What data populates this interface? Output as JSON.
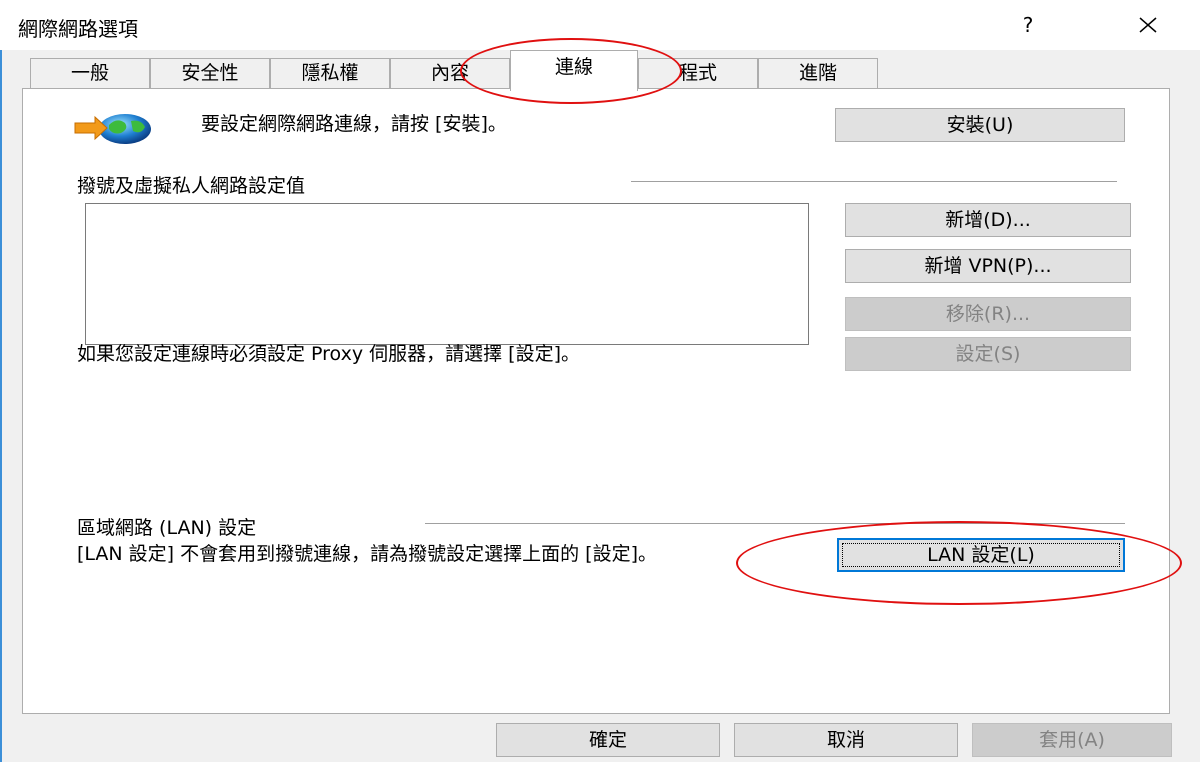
{
  "window": {
    "title": "網際網路選項",
    "help_glyph": "?",
    "close_glyph": "✕"
  },
  "tabs": [
    {
      "label": "一般"
    },
    {
      "label": "安全性"
    },
    {
      "label": "隱私權"
    },
    {
      "label": "內容"
    },
    {
      "label": "連線",
      "active": true
    },
    {
      "label": "程式"
    },
    {
      "label": "進階"
    }
  ],
  "setup": {
    "text": "要設定網際網路連線，請按 [安裝]。",
    "button": "安裝(U)",
    "icon": "network-setup-icon"
  },
  "dialup": {
    "heading": "撥號及虛擬私人網路設定值",
    "add_button": "新增(D)...",
    "add_vpn_button": "新增 VPN(P)...",
    "remove_button": "移除(R)...",
    "settings_button": "設定(S)",
    "proxy_note": "如果您設定連線時必須設定 Proxy 伺服器，請選擇 [設定]。"
  },
  "lan": {
    "heading": "區域網路 (LAN) 設定",
    "note": "[LAN 設定] 不會套用到撥號連線，請為撥號設定選擇上面的 [設定]。",
    "button": "LAN 設定(L)"
  },
  "footer": {
    "ok": "確定",
    "cancel": "取消",
    "apply": "套用(A)"
  },
  "colors": {
    "highlight_circle": "#e01010",
    "accent": "#0078d7"
  }
}
